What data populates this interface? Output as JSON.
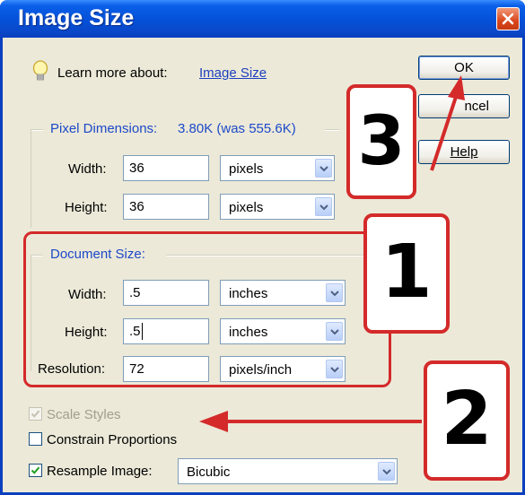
{
  "window": {
    "title": "Image Size"
  },
  "learn_more": {
    "label": "Learn more about:",
    "link": "Image Size"
  },
  "buttons": {
    "ok": "OK",
    "cancel": "ncel",
    "help": "Help"
  },
  "pixel_dimensions": {
    "legend": "Pixel Dimensions:",
    "size_text": "3.80K (was 555.6K)",
    "width": {
      "label": "Width:",
      "value": "36",
      "unit": "pixels"
    },
    "height": {
      "label": "Height:",
      "value": "36",
      "unit": "pixels"
    }
  },
  "document_size": {
    "legend": "Document Size:",
    "width": {
      "label": "Width:",
      "value": ".5",
      "unit": "inches"
    },
    "height": {
      "label": "Height:",
      "value": ".5",
      "unit": "inches"
    },
    "resolution": {
      "label": "Resolution:",
      "value": "72",
      "unit": "pixels/inch"
    }
  },
  "options": {
    "scale_styles": {
      "label": "Scale Styles",
      "checked": true,
      "enabled": false
    },
    "constrain_proportions": {
      "label": "Constrain Proportions",
      "checked": false
    },
    "resample_image": {
      "label": "Resample Image:",
      "checked": true,
      "method": "Bicubic"
    }
  },
  "annotations": {
    "callout_1": "1",
    "callout_2": "2",
    "callout_3": "3"
  },
  "colors": {
    "annotation_red": "#d42a2a",
    "title_blue": "#0550d8",
    "legend_blue": "#1d49c9"
  }
}
